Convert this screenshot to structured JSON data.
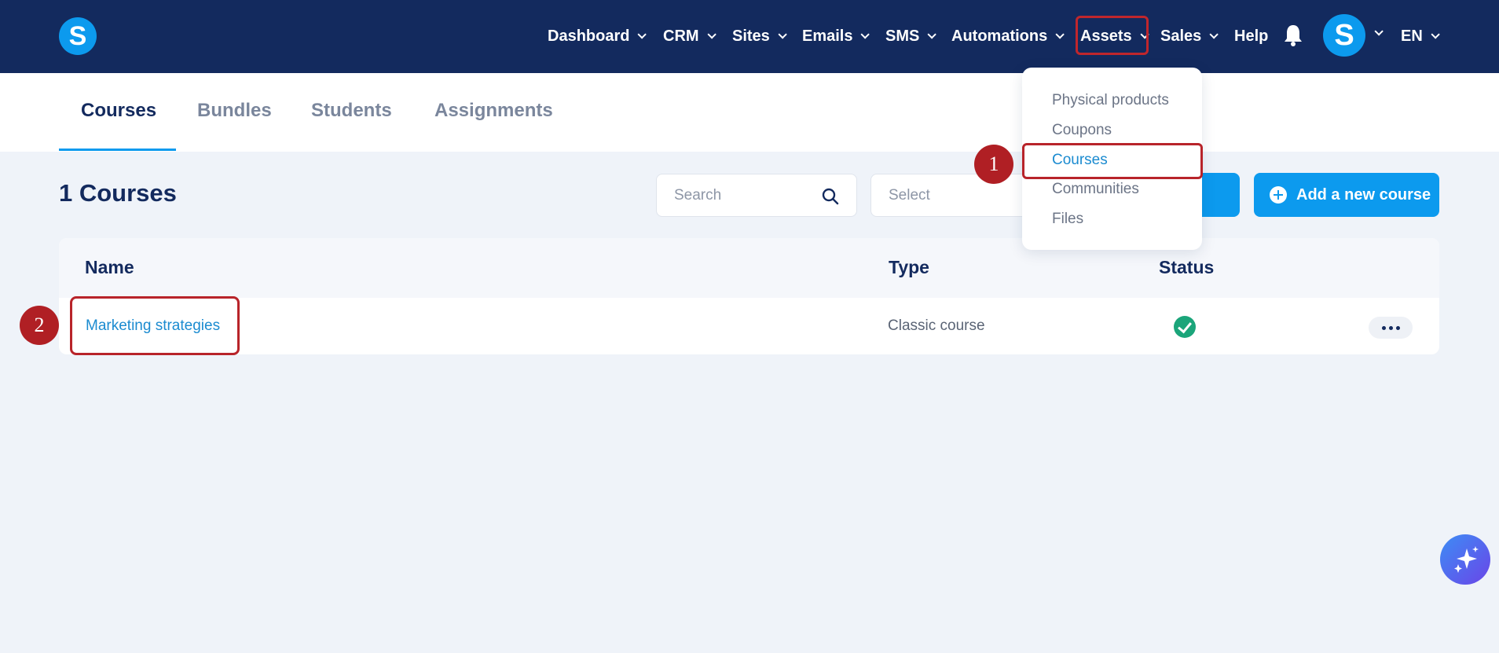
{
  "topbar": {
    "logo": "S",
    "nav": [
      "Dashboard",
      "CRM",
      "Sites",
      "Emails",
      "SMS",
      "Automations",
      "Assets",
      "Sales",
      "Help"
    ],
    "avatar": "S",
    "language": "EN"
  },
  "subtabs": [
    "Courses",
    "Bundles",
    "Students",
    "Assignments"
  ],
  "page": {
    "title": "1 Courses",
    "search_placeholder": "Search",
    "select_placeholder": "Select",
    "add_button": "Add a new course"
  },
  "table": {
    "headers": [
      "Name",
      "Type",
      "Status"
    ],
    "rows": [
      {
        "name": "Marketing strategies",
        "type": "Classic course",
        "status": "active"
      }
    ]
  },
  "assets_menu": {
    "items": [
      "Physical products",
      "Coupons",
      "Courses",
      "Communities",
      "Files"
    ],
    "active": "Courses"
  },
  "markers": [
    "1",
    "2"
  ],
  "colors": {
    "nav_bg": "#132a5e",
    "accent": "#0c9aee",
    "link": "#1b8bd0",
    "highlight": "#b8242a",
    "status_ok": "#1ba57a"
  }
}
